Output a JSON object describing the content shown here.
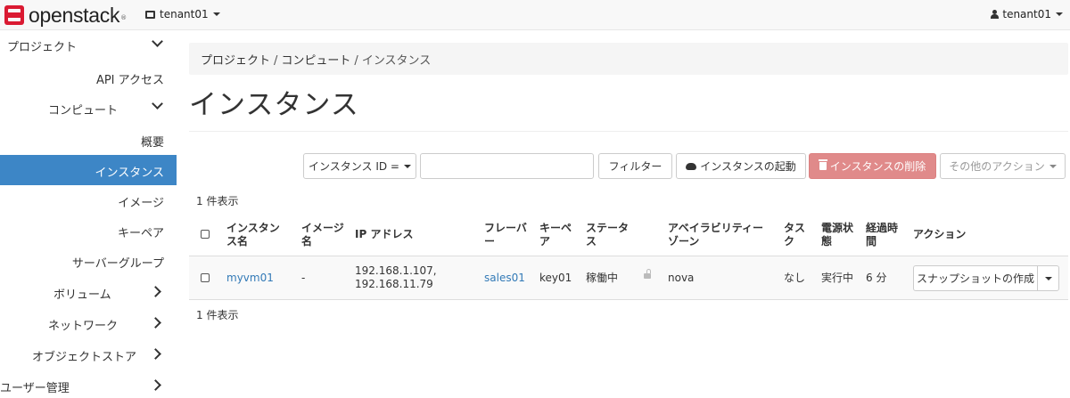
{
  "header": {
    "brand": "openstack",
    "project_picker": "tenant01",
    "user": "tenant01"
  },
  "sidebar": {
    "items": [
      {
        "label": "プロジェクト"
      },
      {
        "label": "API アクセス"
      },
      {
        "label": "コンピュート"
      },
      {
        "label": "概要"
      },
      {
        "label": "インスタンス"
      },
      {
        "label": "イメージ"
      },
      {
        "label": "キーペア"
      },
      {
        "label": "サーバーグループ"
      },
      {
        "label": "ボリューム"
      },
      {
        "label": "ネットワーク"
      },
      {
        "label": "オブジェクトストア"
      },
      {
        "label": "ユーザー管理"
      }
    ]
  },
  "breadcrumb": {
    "items": [
      "プロジェクト",
      "コンピュート",
      "インスタンス"
    ],
    "separator": "/"
  },
  "page": {
    "title": "インスタンス"
  },
  "toolbar": {
    "filter_field": "インスタンス ID =",
    "filter_value": "",
    "filter_button": "フィルター",
    "launch_button": "インスタンスの起動",
    "delete_button": "インスタンスの削除",
    "more_actions": "その他のアクション"
  },
  "table": {
    "count_top": "1 件表示",
    "count_bottom": "1 件表示",
    "headers": {
      "name": [
        "インスタン",
        "ス名"
      ],
      "image": [
        "イメージ",
        "名"
      ],
      "ip": "IP アドレス",
      "flavor": [
        "フレーバ",
        "ー"
      ],
      "keypair": [
        "キーペ",
        "ア"
      ],
      "status": [
        "ステータ",
        "ス"
      ],
      "az": [
        "アベイラビリティー",
        "ゾーン"
      ],
      "task": [
        "タス",
        "ク"
      ],
      "power": [
        "電源状",
        "態"
      ],
      "age": [
        "経過時",
        "間"
      ],
      "actions": "アクション"
    },
    "rows": [
      {
        "name": "myvm01",
        "image": "-",
        "ip": [
          "192.168.1.107,",
          "192.168.11.79"
        ],
        "flavor": "sales01",
        "keypair": "key01",
        "status": "稼働中",
        "az": "nova",
        "task": "なし",
        "power": "実行中",
        "age": "6 分",
        "action": "スナップショットの作成"
      }
    ]
  },
  "colors": {
    "accent": "#3d86c6",
    "danger_button": "#e08a8a",
    "link": "#337ab7",
    "brand": "#da1a32"
  }
}
